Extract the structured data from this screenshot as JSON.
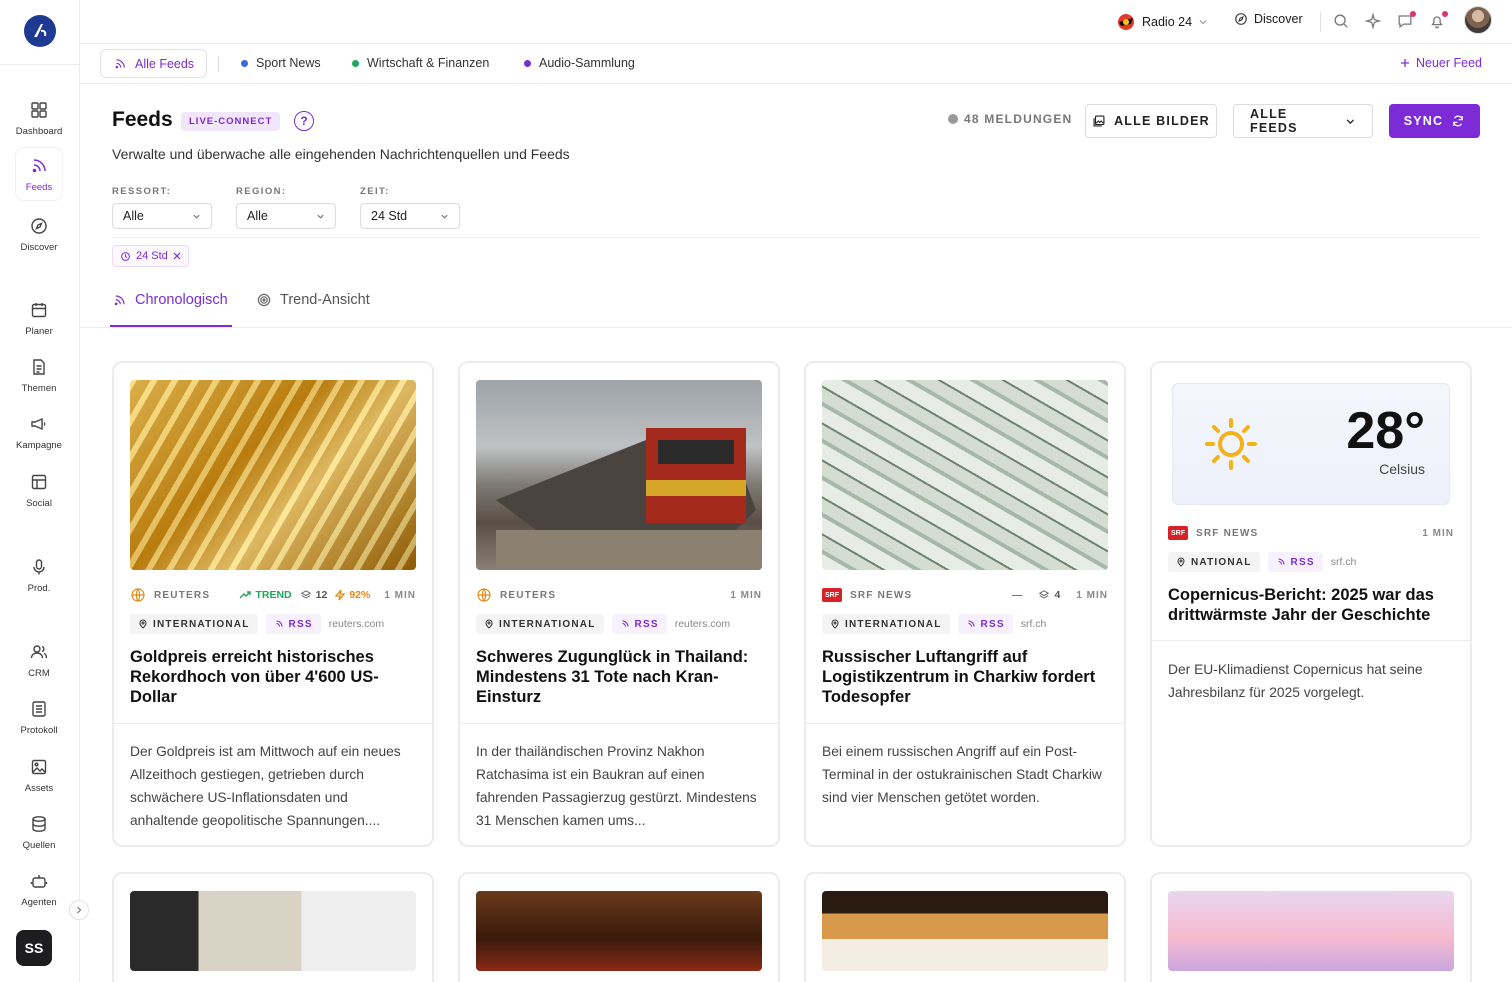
{
  "sidebar": {
    "items": [
      {
        "label": "Dashboard",
        "icon": "grid-icon"
      },
      {
        "label": "Feeds",
        "icon": "rss-icon",
        "active": true
      },
      {
        "label": "Discover",
        "icon": "compass-icon"
      },
      {
        "label": "Planer",
        "icon": "calendar-icon"
      },
      {
        "label": "Themen",
        "icon": "document-icon"
      },
      {
        "label": "Kampagne",
        "icon": "megaphone-icon"
      },
      {
        "label": "Social",
        "icon": "layout-icon"
      },
      {
        "label": "Prod.",
        "icon": "microphone-icon"
      },
      {
        "label": "CRM",
        "icon": "users-icon"
      },
      {
        "label": "Protokoll",
        "icon": "list-icon"
      },
      {
        "label": "Assets",
        "icon": "image-icon"
      },
      {
        "label": "Quellen",
        "icon": "database-icon"
      },
      {
        "label": "Agenten",
        "icon": "robot-icon"
      }
    ],
    "user_initials": "SS"
  },
  "topbar": {
    "station": "Radio 24",
    "discover": "Discover"
  },
  "feedbar": {
    "all": "Alle Feeds",
    "items": [
      {
        "label": "Sport News",
        "color": "#2f6fdc"
      },
      {
        "label": "Wirtschaft & Finanzen",
        "color": "#1fa85a"
      },
      {
        "label": "Audio-Sammlung",
        "color": "#7c2bd6"
      }
    ],
    "new_feed": "Neuer Feed"
  },
  "header": {
    "title": "Feeds",
    "badge": "LIVE-CONNECT",
    "help": "?",
    "subtitle": "Verwalte und überwache alle eingehenden Nachrichtenquellen und Feeds",
    "count": "48 MELDUNGEN",
    "all_images": "ALLE BILDER",
    "all_feeds": "ALLE FEEDS",
    "sync": "SYNC"
  },
  "filters": {
    "ressort_label": "RESSORT:",
    "ressort_value": "Alle",
    "region_label": "REGION:",
    "region_value": "Alle",
    "zeit_label": "ZEIT:",
    "zeit_value": "24 Std",
    "chip": "24 Std"
  },
  "view_tabs": {
    "chrono": "Chronologisch",
    "trend": "Trend-Ansicht"
  },
  "cards": [
    {
      "source": "REUTERS",
      "trend": "TREND",
      "stack": "12",
      "score": "92%",
      "time": "1 MIN",
      "region": "INTERNATIONAL",
      "type": "RSS",
      "domain": "reuters.com",
      "title": "Goldpreis erreicht historisches Rekordhoch von über 4'600 US-Dollar",
      "desc": "Der Goldpreis ist am Mittwoch auf ein neues Allzeithoch gestiegen, getrieben durch schwächere US-Inflationsdaten und anhaltende geopolitische Spannungen...."
    },
    {
      "source": "REUTERS",
      "time": "1 MIN",
      "region": "INTERNATIONAL",
      "type": "RSS",
      "domain": "reuters.com",
      "title": "Schweres Zugunglück in Thailand: Mindestens 31 Tote nach Kran-Einsturz",
      "desc": "In der thailändischen Provinz Nakhon Ratchasima ist ein Baukran auf einen fahrenden Passagierzug gestürzt. Mindestens 31 Menschen kamen ums..."
    },
    {
      "source": "SRF NEWS",
      "logo": "SRF",
      "dash": "—",
      "stack": "4",
      "time": "1 MIN",
      "region": "INTERNATIONAL",
      "type": "RSS",
      "domain": "srf.ch",
      "title": "Russischer Luftangriff auf Logistikzentrum in Charkiw fordert Todesopfer",
      "desc": "Bei einem russischen Angriff auf ein Post-Terminal in der ostukrainischen Stadt Charkiw sind vier Menschen getötet worden."
    },
    {
      "source": "SRF NEWS",
      "logo": "SRF",
      "time": "1 MIN",
      "region": "NATIONAL",
      "type": "RSS",
      "domain": "srf.ch",
      "weather_temp": "28°",
      "weather_unit": "Celsius",
      "title": "Copernicus-Bericht: 2025 war das drittwärmste Jahr der Geschichte",
      "desc": "Der EU-Klimadienst Copernicus hat seine Jahresbilanz für 2025 vorgelegt."
    }
  ],
  "colors": {
    "accent": "#7c2bd6",
    "trend": "#1fa85a",
    "score": "#e0891a",
    "srf": "#d82127"
  }
}
